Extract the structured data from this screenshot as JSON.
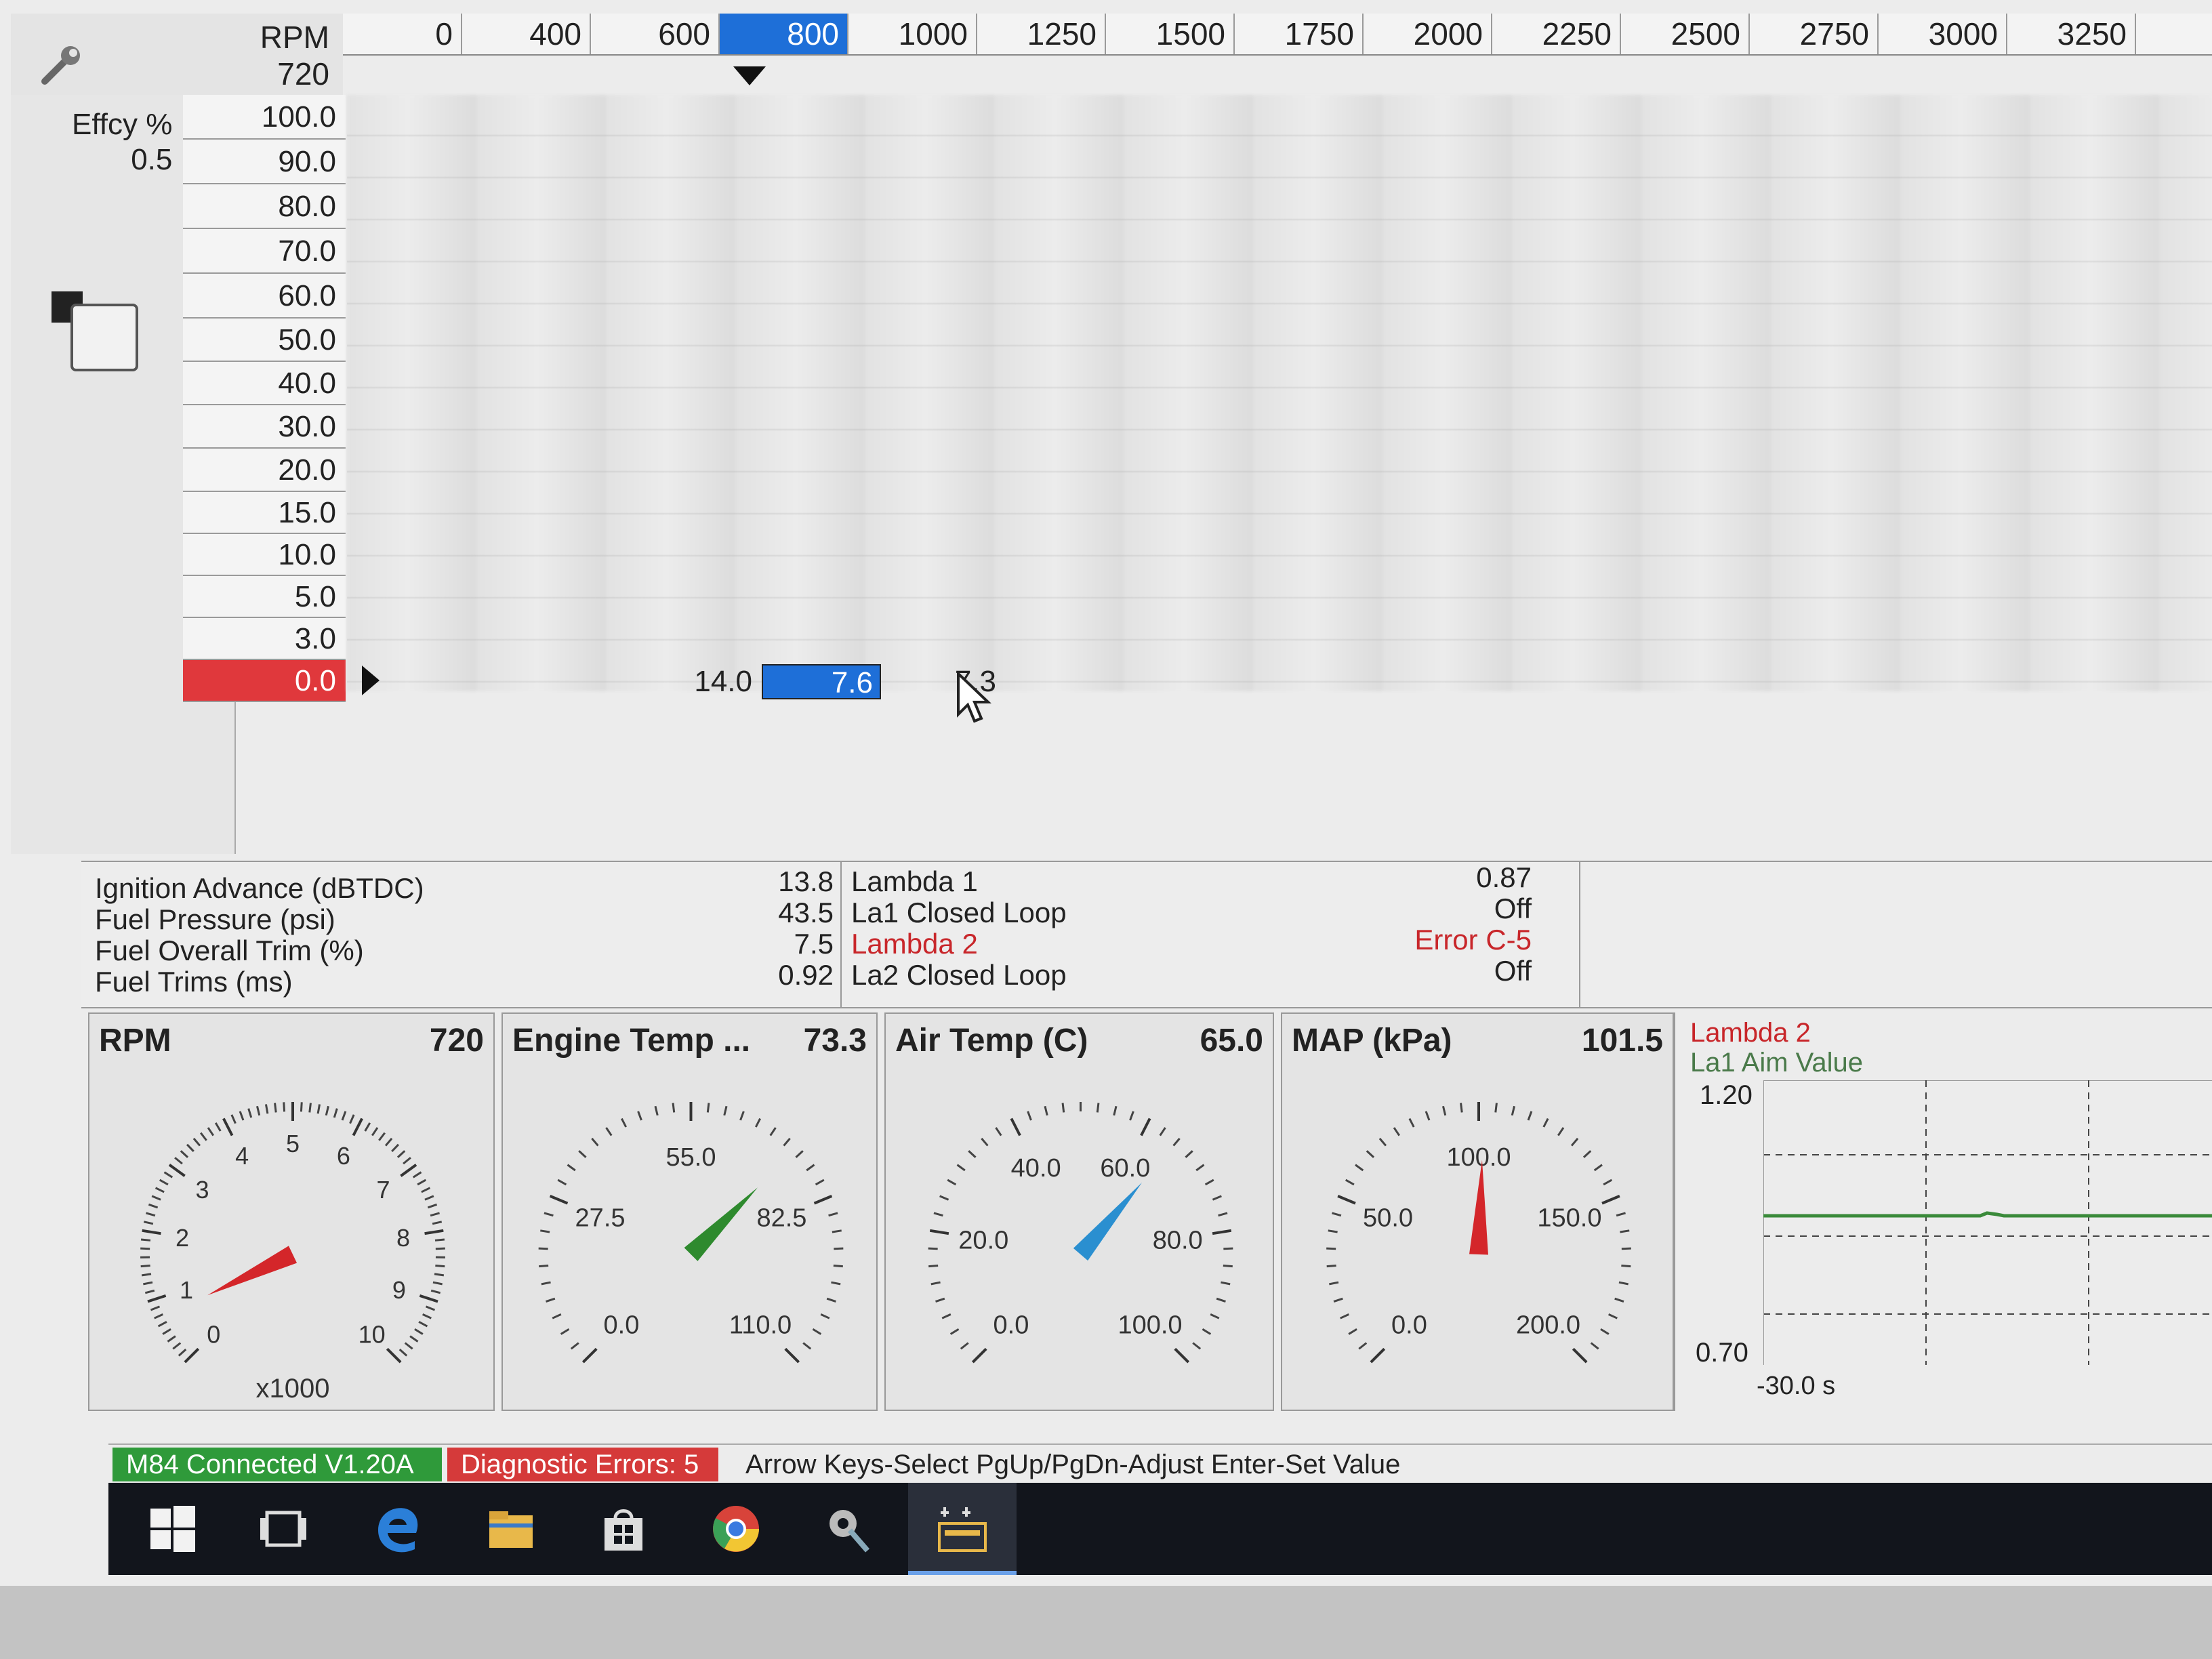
{
  "table": {
    "rpm_label": "RPM",
    "rpm_value": "720",
    "rpm_columns": [
      "0",
      "400",
      "600",
      "800",
      "1000",
      "1250",
      "1500",
      "1750",
      "2000",
      "2250",
      "2500",
      "2750",
      "3000",
      "3250"
    ],
    "selected_rpm": "800",
    "effcy_label": "Effcy %",
    "effcy_value": "0.5",
    "load_rows": [
      "100.0",
      "90.0",
      "80.0",
      "70.0",
      "60.0",
      "50.0",
      "40.0",
      "30.0",
      "20.0",
      "15.0",
      "10.0",
      "5.0",
      "3.0",
      "0.0"
    ],
    "active_load": "0.0",
    "active_row_values": [
      "14.0",
      "7.6",
      "7.3"
    ]
  },
  "readouts": {
    "left_labels": [
      "Ignition Advance (dBTDC)",
      "Fuel Pressure (psi)",
      "Fuel Overall Trim (%)",
      "Fuel Trims (ms)"
    ],
    "left_values": [
      "13.8",
      "43.5",
      "7.5",
      "0.92"
    ],
    "right_labels": [
      "Lambda 1",
      "La1 Closed Loop",
      "Lambda 2",
      "La2 Closed Loop"
    ],
    "right_values": [
      "0.87",
      "Off",
      "Error C-5",
      "Off"
    ]
  },
  "gauges": {
    "rpm": {
      "title": "RPM",
      "value": "720",
      "unit": "x1000",
      "ticks": [
        "0",
        "1",
        "2",
        "3",
        "4",
        "5",
        "6",
        "7",
        "8",
        "9",
        "10"
      ],
      "needle_color": "#d4262a"
    },
    "engine_temp": {
      "title": "Engine Temp ...",
      "value": "73.3",
      "ticks": [
        "0.0",
        "27.5",
        "55.0",
        "82.5",
        "110.0"
      ],
      "needle_color": "#2e8a2e"
    },
    "air_temp": {
      "title": "Air Temp (C)",
      "value": "65.0",
      "ticks": [
        "0.0",
        "20.0",
        "40.0",
        "60.0",
        "80.0",
        "100.0"
      ],
      "needle_color": "#2a8fd0"
    },
    "map": {
      "title": "MAP (kPa)",
      "value": "101.5",
      "ticks": [
        "0.0",
        "50.0",
        "100.0",
        "150.0",
        "200.0"
      ],
      "needle_color": "#d4262a"
    }
  },
  "chart": {
    "series1": "Lambda 2",
    "series2": "La1 Aim Value",
    "ymax": "1.20",
    "ymin": "0.70",
    "xlabel": "-30.0 s"
  },
  "status": {
    "connection": "M84 Connected V1.20A",
    "errors": "Diagnostic Errors: 5",
    "help": "Arrow Keys-Select  PgUp/PgDn-Adjust  Enter-Set Value"
  }
}
